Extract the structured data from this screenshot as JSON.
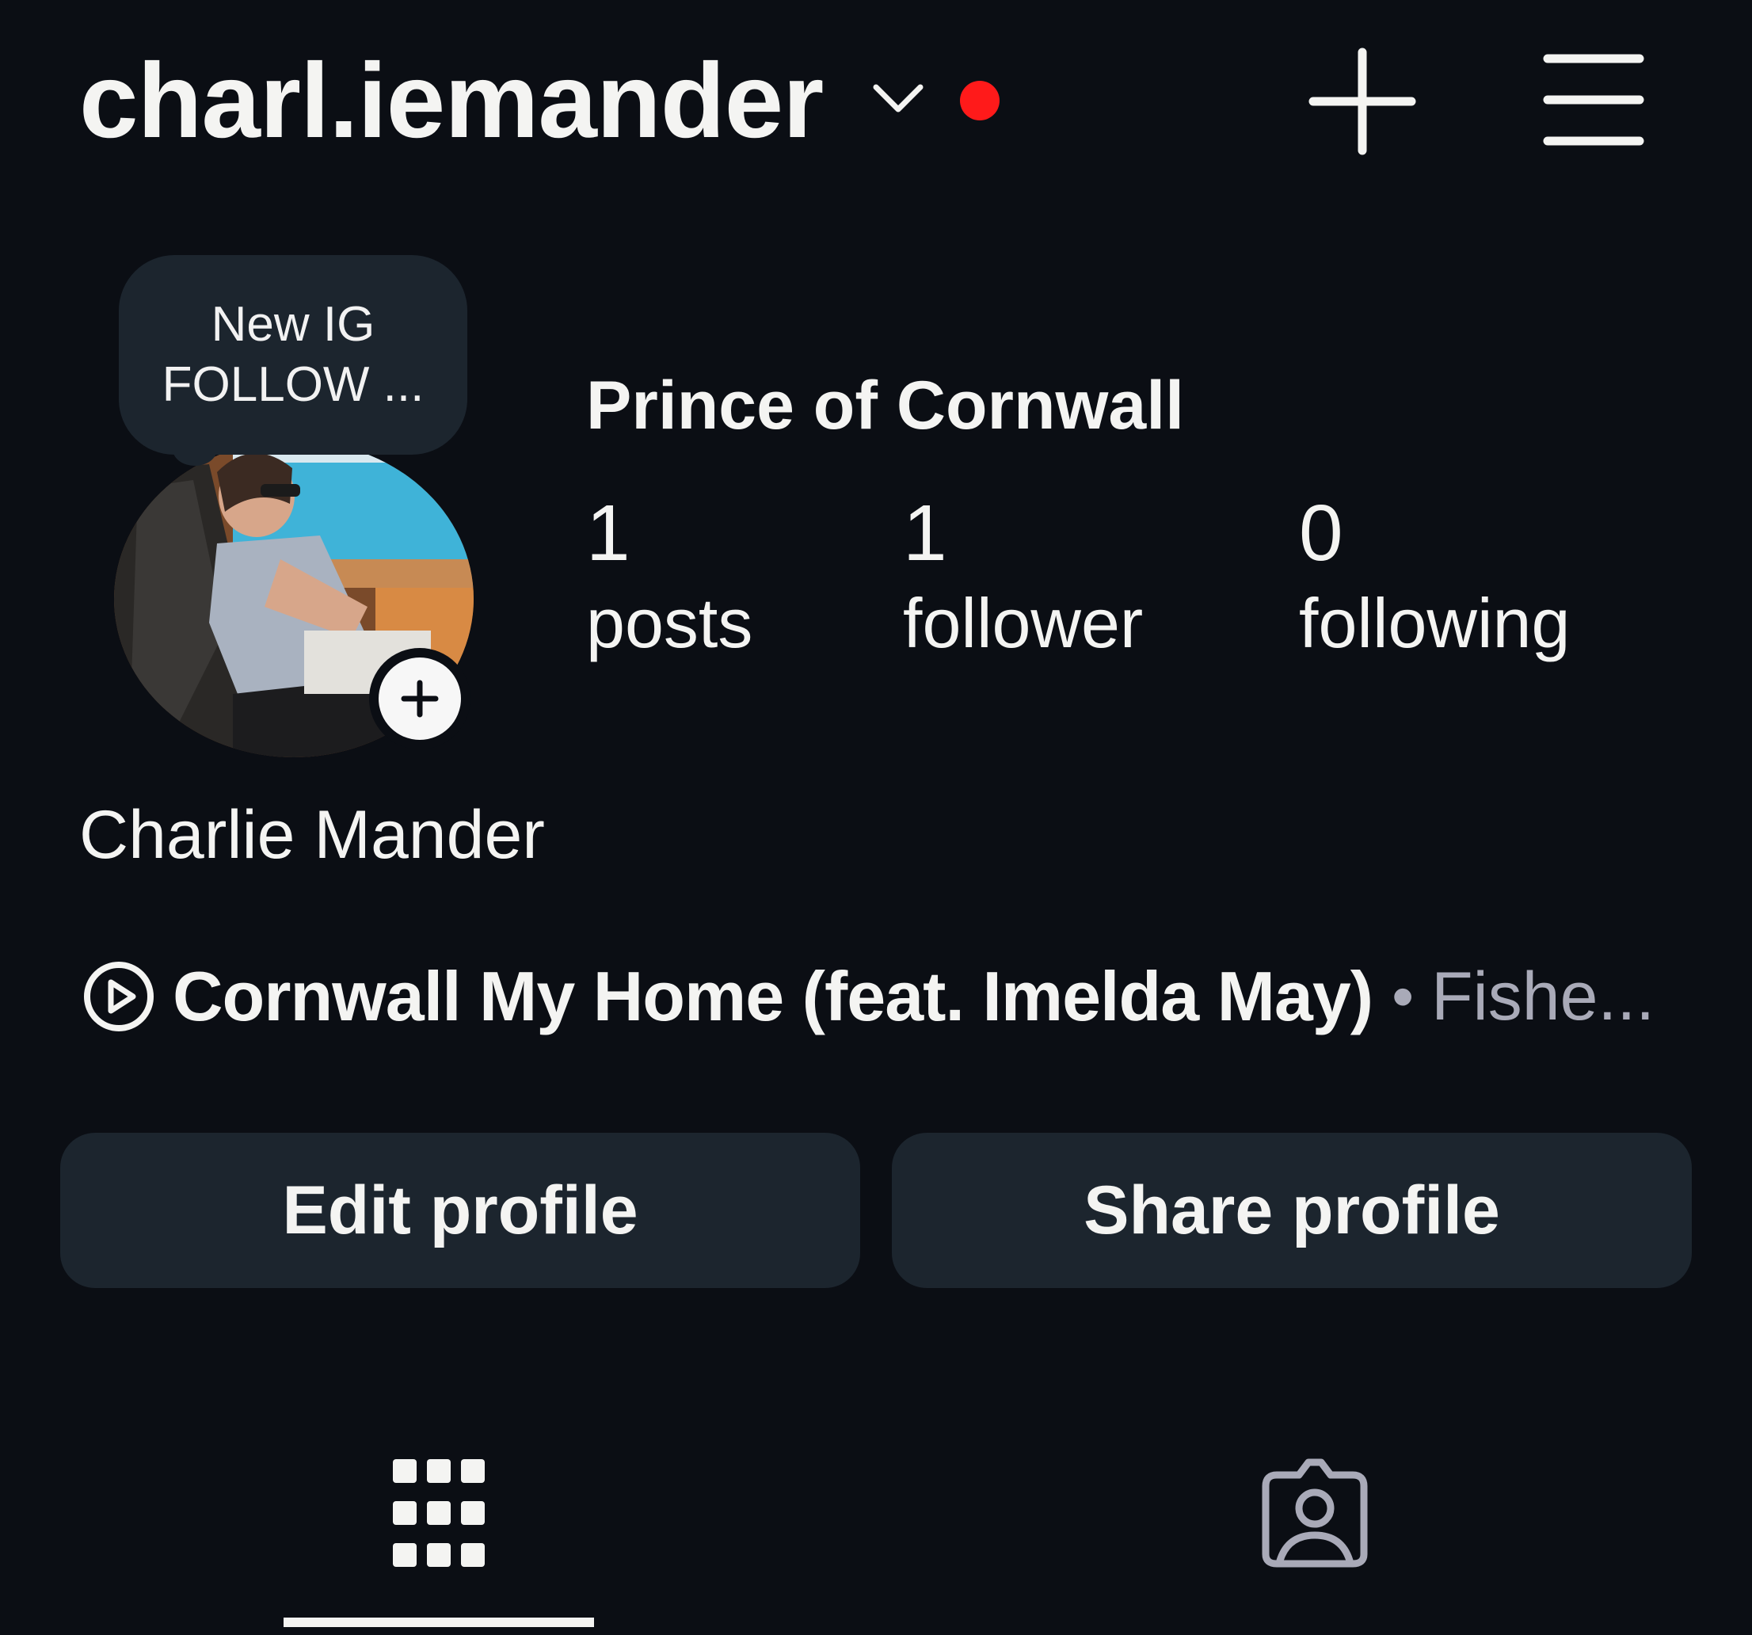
{
  "header": {
    "username": "charl.iemander",
    "icons": {
      "chevron": "chevron-down-icon",
      "notification_dot": "notification-dot",
      "create": "plus-icon",
      "menu": "hamburger-menu-icon"
    },
    "notification_dot_color": "#ff1a1a"
  },
  "note": {
    "line1": "New IG",
    "line2": "FOLLOW ..."
  },
  "profile": {
    "category": "Prince of Cornwall",
    "display_name": "Charlie Mander",
    "avatar_add_icon": "plus-icon"
  },
  "stats": {
    "posts": {
      "value": "1",
      "label": "posts"
    },
    "followers": {
      "value": "1",
      "label": "follower"
    },
    "following": {
      "value": "0",
      "label": "following"
    }
  },
  "music": {
    "icon": "play-circle-icon",
    "title": "Cornwall My Home (feat. Imelda May)",
    "separator": "•",
    "artist": "Fishe..."
  },
  "buttons": {
    "edit_profile": "Edit profile",
    "share_profile": "Share profile"
  },
  "tabs": [
    {
      "name": "posts-grid",
      "icon": "grid-icon",
      "active": true
    },
    {
      "name": "tagged",
      "icon": "tagged-person-icon",
      "active": false
    }
  ],
  "colors": {
    "background": "#0b0e14",
    "button_bg": "#1c252e",
    "text": "#f4f4f2",
    "muted_text": "#a9aab8"
  }
}
